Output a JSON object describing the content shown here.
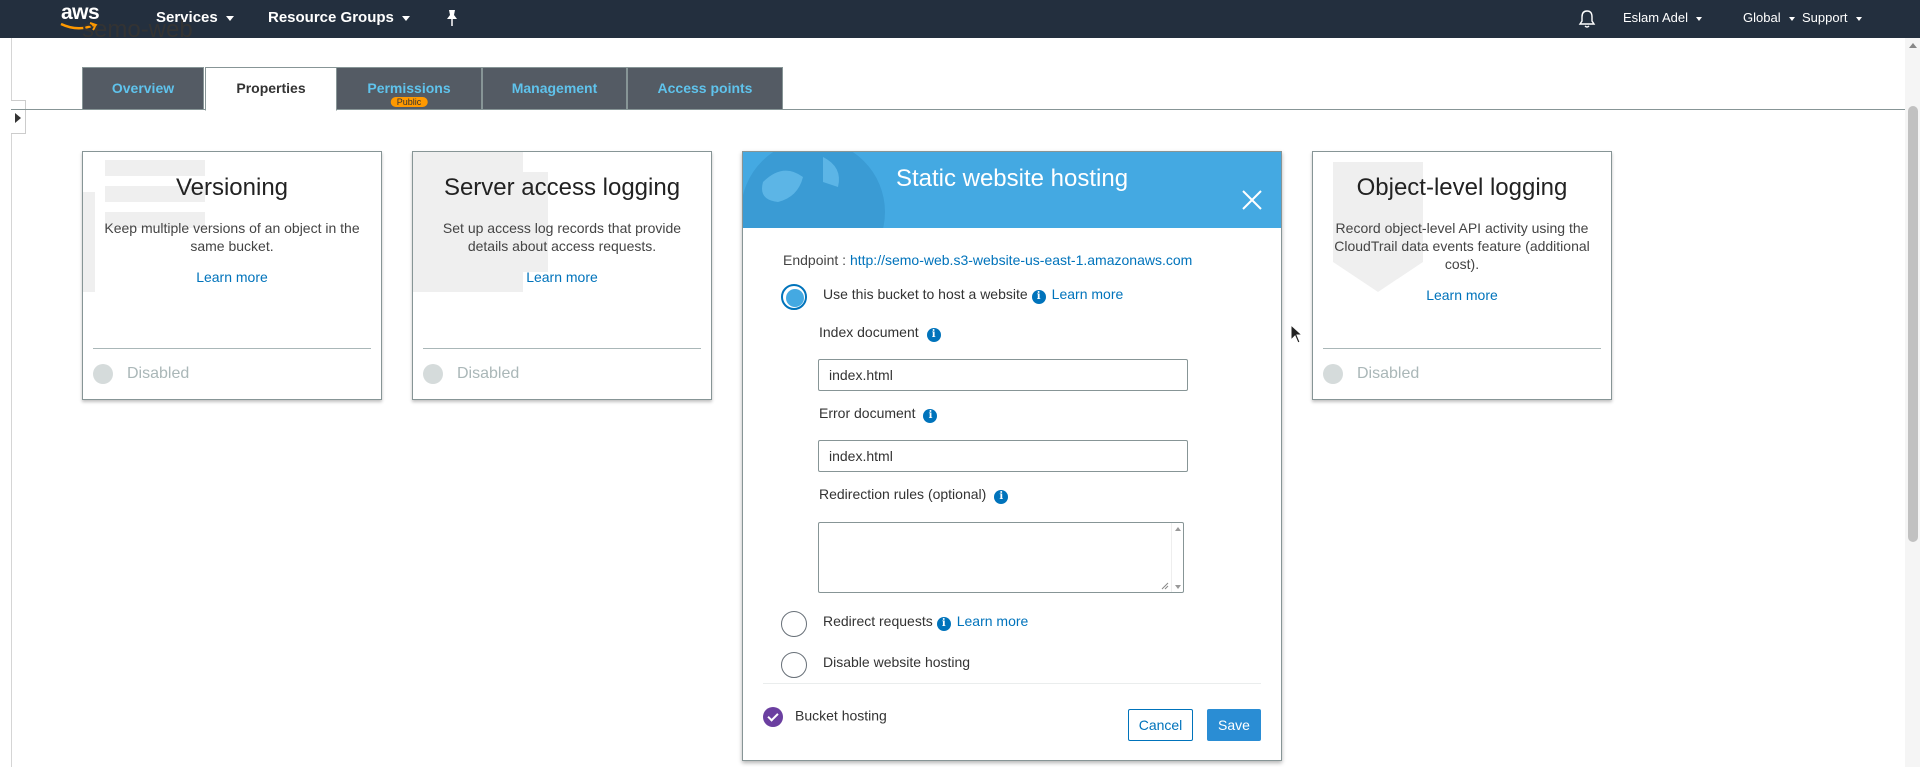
{
  "topnav": {
    "logo_text": "aws",
    "services": "Services",
    "resource_groups": "Resource Groups",
    "user": "Eslam Adel",
    "region": "Global",
    "support": "Support",
    "bg_color": "#232f3e"
  },
  "page": {
    "title": "semo-web"
  },
  "tabs": [
    {
      "label": "Overview",
      "active": false
    },
    {
      "label": "Properties",
      "active": true
    },
    {
      "label": "Permissions",
      "badge": "Public",
      "active": false
    },
    {
      "label": "Management",
      "active": false
    },
    {
      "label": "Access points",
      "active": false
    }
  ],
  "cards": {
    "versioning": {
      "title": "Versioning",
      "desc": "Keep multiple versions of an object in the same bucket.",
      "learn": "Learn more",
      "status": "Disabled"
    },
    "logging": {
      "title": "Server access logging",
      "desc": "Set up access log records that provide details about access requests.",
      "learn": "Learn more",
      "status": "Disabled"
    },
    "object_logging": {
      "title": "Object-level logging",
      "desc": "Record object-level API activity using the CloudTrail data events feature (additional cost).",
      "learn": "Learn more",
      "status": "Disabled"
    }
  },
  "hosting": {
    "title": "Static website hosting",
    "endpoint_label": "Endpoint :",
    "endpoint_url": "http://semo-web.s3-website-us-east-1.amazonaws.com",
    "option_host": "Use this bucket to host a website",
    "option_host_learn": "Learn more",
    "index_label": "Index document",
    "index_value": "index.html",
    "error_label": "Error document",
    "error_value": "index.html",
    "redirection_label": "Redirection rules (optional)",
    "option_redirect": "Redirect requests",
    "option_redirect_learn": "Learn more",
    "option_disable": "Disable website hosting",
    "bucket_hosting": "Bucket hosting",
    "cancel": "Cancel",
    "save": "Save",
    "header_color": "#44a9e2"
  }
}
